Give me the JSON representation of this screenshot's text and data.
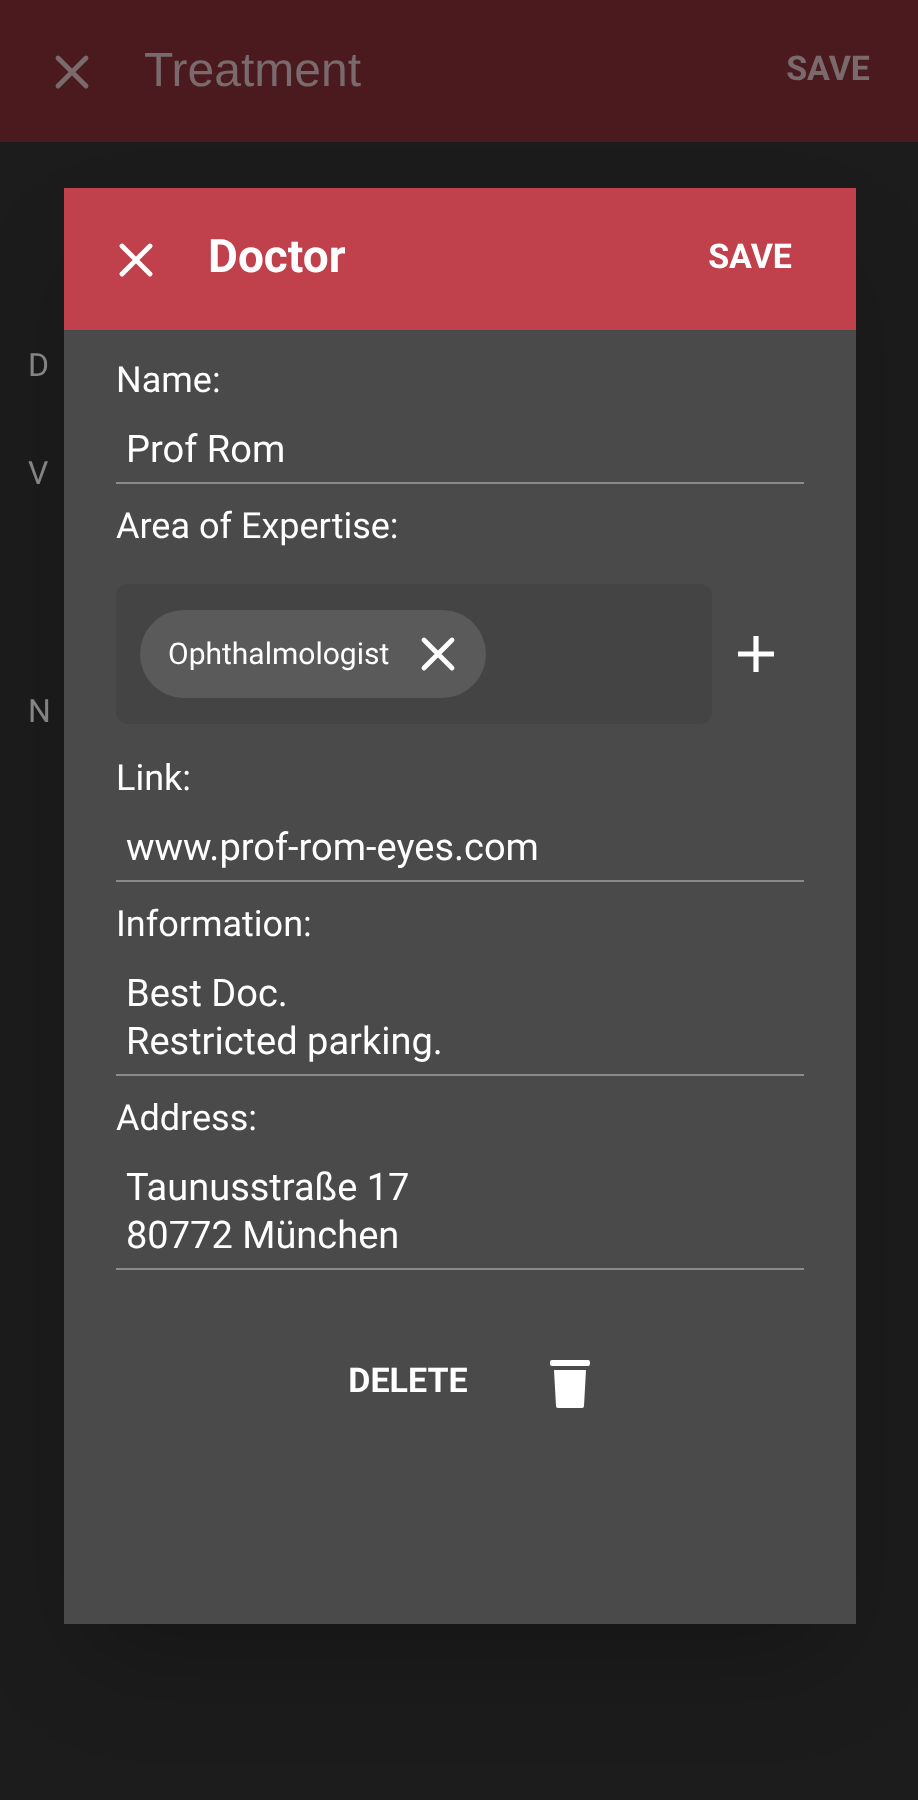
{
  "background": {
    "title": "Treatment",
    "save": "SAVE",
    "labels": [
      "D",
      "V",
      "N"
    ]
  },
  "dialog": {
    "title": "Doctor",
    "save": "SAVE",
    "fields": [
      {
        "kind": "text",
        "label": "Name:",
        "value": "Prof Rom"
      },
      {
        "kind": "chips",
        "label": "Area of Expertise:",
        "chips": [
          "Ophthalmologist"
        ]
      },
      {
        "kind": "text",
        "label": "Link:",
        "value": "www.prof-rom-eyes.com"
      },
      {
        "kind": "text",
        "label": "Information:",
        "value": "Best Doc.\nRestricted parking."
      },
      {
        "kind": "text",
        "label": "Address:",
        "value": "Taunusstraße 17\n80772 München"
      }
    ],
    "delete": "DELETE"
  }
}
